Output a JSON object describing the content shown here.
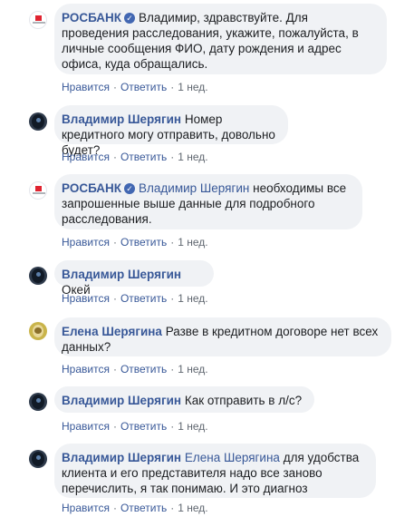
{
  "comments": [
    {
      "author": "РОСБАНК",
      "verified": true,
      "mention": "",
      "text": "Владимир, здравствуйте. Для проведения расследования, укажите, пожалуйста, в личные сообщения ФИО, дату рождения и адрес офиса, куда обращались.",
      "like": "Нравится",
      "reply": "Ответить",
      "time": "1 нед."
    },
    {
      "author": "Владимир Шерягин",
      "mention": "",
      "text": "Номер кредитного могу отправить, довольно будет?",
      "like": "Нравится",
      "reply": "Ответить",
      "time": "1 нед."
    },
    {
      "author": "РОСБАНК",
      "verified": true,
      "mention": "Владимир Шерягин",
      "text": "необходимы все запрошенные выше данные для подробного расследования.",
      "like": "Нравится",
      "reply": "Ответить",
      "time": "1 нед."
    },
    {
      "author": "Владимир Шерягин",
      "mention": "",
      "text": "Окей",
      "like": "Нравится",
      "reply": "Ответить",
      "time": "1 нед."
    },
    {
      "author": "Елена Шерягина",
      "mention": "",
      "text": "Разве в кредитном договоре нет всех данных?",
      "like": "Нравится",
      "reply": "Ответить",
      "time": "1 нед."
    },
    {
      "author": "Владимир Шерягин",
      "mention": "",
      "text": "Как отправить в л/с?",
      "like": "Нравится",
      "reply": "Ответить",
      "time": "1 нед."
    },
    {
      "author": "Владимир Шерягин",
      "mention": "Елена Шерягина",
      "text": "для удобства клиента и его представителя надо все заново перечислить, я так понимаю. И это диагноз",
      "like": "Нравится",
      "reply": "Ответить",
      "time": "1 нед."
    }
  ],
  "icons": {
    "verified": "verified-check-icon"
  },
  "colors": {
    "author": "#385898",
    "bubble": "#f0f2f5",
    "meta": "#606770",
    "brand_red": "#e02330"
  }
}
